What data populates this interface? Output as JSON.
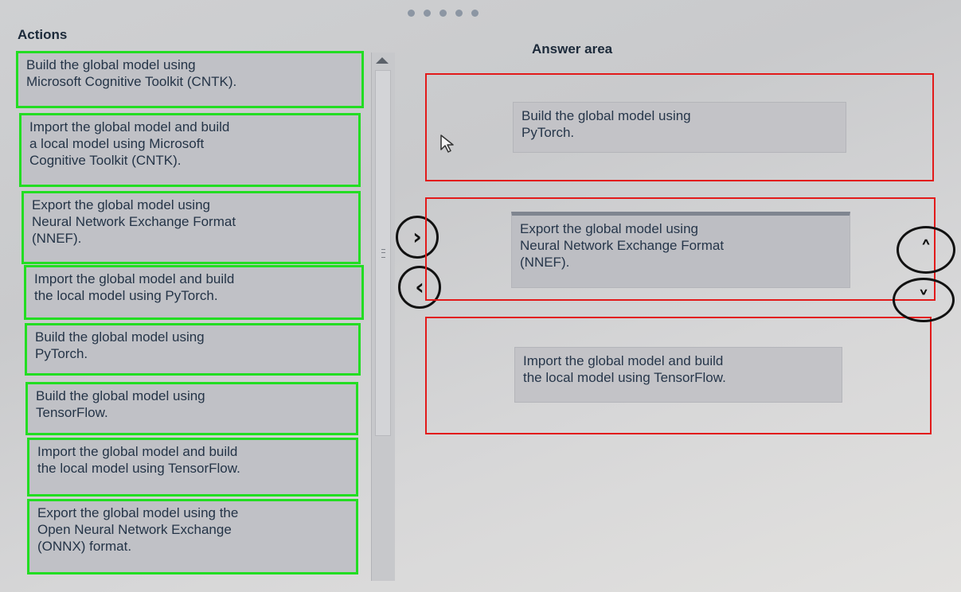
{
  "pager": {
    "count": 5
  },
  "actions": {
    "title": "Actions",
    "items": [
      {
        "lines": [
          "Build the global model using",
          "Microsoft Cognitive Toolkit (CNTK)."
        ]
      },
      {
        "lines": [
          "Import the global model and build",
          "a local model using Microsoft",
          "Cognitive Toolkit (CNTK)."
        ]
      },
      {
        "lines": [
          "Export the global model using",
          "Neural Network Exchange Format",
          "(NNEF)."
        ]
      },
      {
        "lines": [
          "Import the global model and build",
          "the local model using PyTorch."
        ]
      },
      {
        "lines": [
          "Build the global model using",
          "PyTorch."
        ]
      },
      {
        "lines": [
          "Build the global model using",
          "TensorFlow."
        ]
      },
      {
        "lines": [
          "Import the global model and build",
          "the local model using TensorFlow."
        ]
      },
      {
        "lines": [
          "Export the global model using the",
          "Open Neural Network Exchange",
          "(ONNX) format."
        ]
      }
    ]
  },
  "answer": {
    "title": "Answer area",
    "items": [
      {
        "lines": [
          "Build the global model using",
          "PyTorch."
        ]
      },
      {
        "lines": [
          "Export the global model using",
          "Neural Network Exchange Format",
          "(NNEF)."
        ]
      },
      {
        "lines": [
          "Import the global model and build",
          "the local model using TensorFlow."
        ]
      }
    ]
  },
  "buttons": {
    "move_right": "›",
    "move_left": "‹",
    "move_up": "˄",
    "move_down": "˅"
  },
  "colors": {
    "action_outline": "#22dd22",
    "answer_outline": "#e21a1a"
  }
}
